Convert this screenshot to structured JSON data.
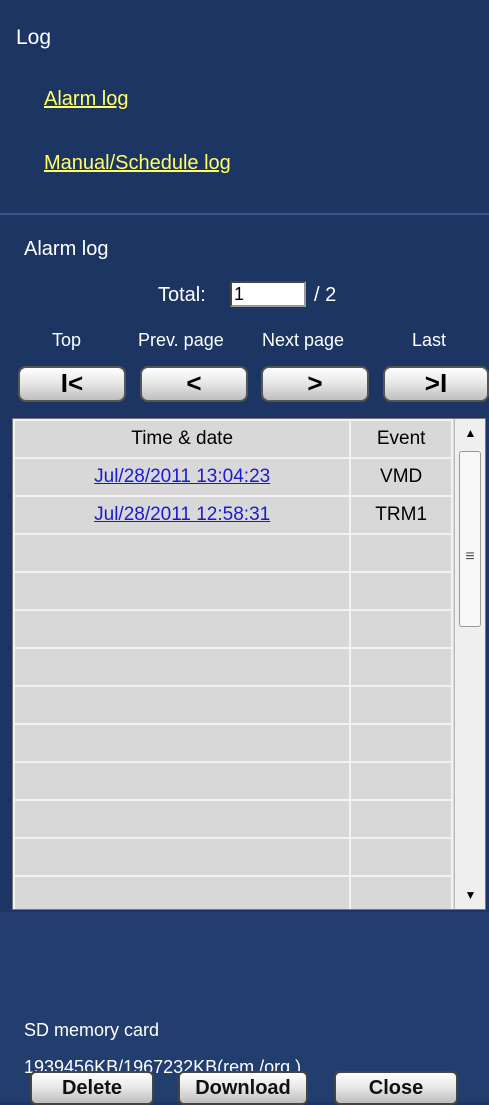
{
  "log_section": {
    "title": "Log",
    "links": [
      "Alarm log",
      "Manual/Schedule log"
    ]
  },
  "alarm_log": {
    "title": "Alarm log",
    "total_label": "Total:",
    "current_page": "1",
    "total_pages": "/ 2",
    "nav_labels": {
      "top": "Top",
      "prev": "Prev. page",
      "next": "Next page",
      "last": "Last"
    },
    "nav_buttons": {
      "top": "I<",
      "prev": "<",
      "next": ">",
      "last": ">I"
    },
    "table": {
      "headers": [
        "Time & date",
        "Event"
      ],
      "rows": [
        {
          "time": "Jul/28/2011 13:04:23",
          "event": "VMD"
        },
        {
          "time": "Jul/28/2011 12:58:31",
          "event": "TRM1"
        },
        {
          "time": "",
          "event": ""
        },
        {
          "time": "",
          "event": ""
        },
        {
          "time": "",
          "event": ""
        },
        {
          "time": "",
          "event": ""
        },
        {
          "time": "",
          "event": ""
        },
        {
          "time": "",
          "event": ""
        },
        {
          "time": "",
          "event": ""
        },
        {
          "time": "",
          "event": ""
        },
        {
          "time": "",
          "event": ""
        },
        {
          "time": "",
          "event": ""
        }
      ]
    }
  },
  "sd_card": {
    "label": "SD memory card",
    "value": "1939456KB/1967232KB(rem./org.)"
  },
  "actions": {
    "delete": "Delete",
    "download": "Download",
    "close": "Close"
  },
  "colors": {
    "background": "#1c3563",
    "link": "#ffff66",
    "table_link": "#1a1ad0"
  }
}
